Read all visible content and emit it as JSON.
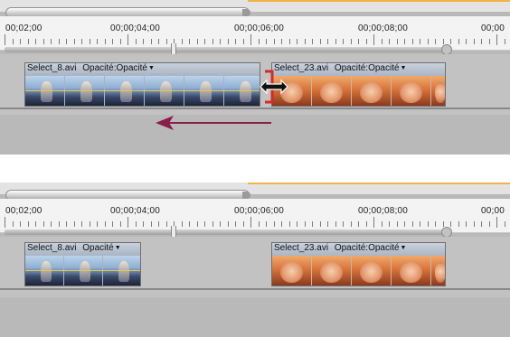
{
  "timecodes": [
    "00;02;00",
    "00;00;04;00",
    "00;00;06;00",
    "00;00;08;00",
    "00;00"
  ],
  "top": {
    "clip_a": {
      "name": "Select_8.avi",
      "effect": "Opacité:Opacité"
    },
    "clip_b": {
      "name": "Select_23.avi",
      "effect": "Opacité:Opacité"
    }
  },
  "bottom": {
    "clip_a": {
      "name": "Select_8.avi",
      "effect": "Opacité"
    },
    "clip_b": {
      "name": "Select_23.avi",
      "effect": "Opacité:Opacité"
    }
  },
  "icons": [
    "ripple-edit-cursor-icon",
    "drag-left-arrow-icon",
    "dropdown-arrow-icon"
  ],
  "colors": {
    "panel": "#b9b9b9",
    "ruler": "#f3f3f3",
    "clip_header": "#a9b4c3",
    "cursor_red": "#d42a2a",
    "arrow": "#8a1d4a",
    "accent_orange": "#f2b24a"
  }
}
